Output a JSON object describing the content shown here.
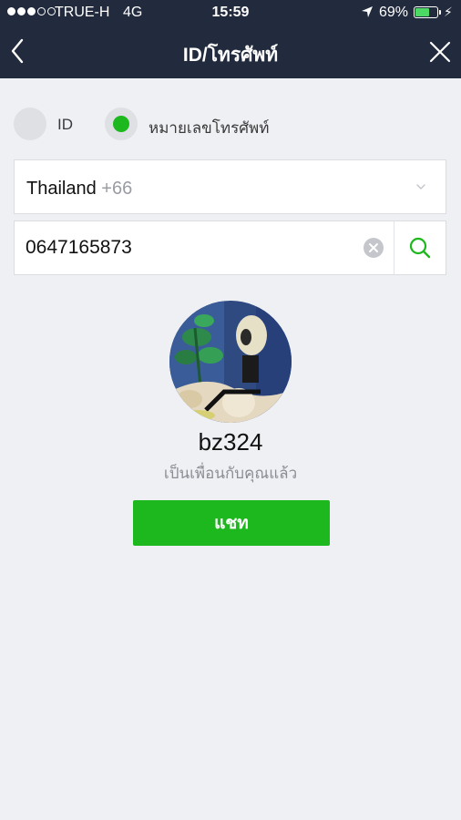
{
  "status_bar": {
    "carrier": "TRUE-H",
    "network": "4G",
    "time": "15:59",
    "battery_percent": "69%",
    "battery_level": 0.69,
    "signal_bars": 3
  },
  "nav": {
    "title": "ID/โทรศัพท์",
    "back_icon": "chevron-left-icon",
    "close_icon": "close-icon"
  },
  "search_type": {
    "options": [
      {
        "label": "ID",
        "selected": false
      },
      {
        "label": "หมายเลขโทรศัพท์",
        "selected": true
      }
    ]
  },
  "country": {
    "name": "Thailand",
    "code": "+66"
  },
  "phone": {
    "value": "0647165873"
  },
  "result": {
    "name": "bz324",
    "status": "เป็นเพื่อนกับคุณแล้ว",
    "chat_label": "แชท"
  },
  "colors": {
    "header": "#222b3d",
    "accent": "#1cb81d",
    "background": "#eff0f4"
  }
}
